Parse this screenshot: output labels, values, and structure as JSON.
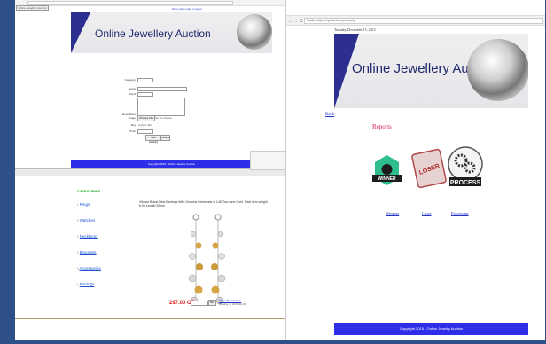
{
  "left_window": {
    "tab_label": "Online Jewellery Auction",
    "top_link": "Not a user  Login | Logout",
    "banner_title": "Online Jewellery Auction",
    "form": {
      "category_label": "Category",
      "category_value": "Rings",
      "name_label": "Name",
      "brand_label": "Brand",
      "description_label": "Description",
      "image_label": "Image",
      "choose_file": "Choose File",
      "no_file": "No file chosen",
      "buy_label": "Buy",
      "buy_options": [
        "Auction",
        "Buy"
      ],
      "price_label": "Price",
      "add_button": "Add Jewelry",
      "cancel_button": "Cancel"
    },
    "footer": "Copyright 2015 - Online Jewelry Auction"
  },
  "bottom_window": {
    "categories_title": "CATEGORIES",
    "categories": [
      "Rings",
      "Watches",
      "Necklaces",
      "Bracelets",
      "Accessories",
      "Earrings"
    ],
    "product_title": "Vibrant Brand New Earrings With Genuine Diamonds in 14K Two-tone Gold. Total item weight 6.5g.Length 52mm",
    "price": "297.00 OR",
    "bid_button": "Bid",
    "close_note": "Close Bid / Auction",
    "close_date": "Closing on 2015-10-10"
  },
  "right_window": {
    "url": "localhost/jewelry/admin/reports.php",
    "welcome": "Tuesday, December 15, 2015",
    "banner_title": "Online Jewellery Auction",
    "back_link": "Back",
    "heading": "Reports",
    "reports": [
      "Winners",
      "Loses",
      "Processing"
    ],
    "badges": [
      "WINNER",
      "LOSER",
      "PROCESS"
    ],
    "footer": "Copyright 2015 - Online Jewelry Auction"
  }
}
